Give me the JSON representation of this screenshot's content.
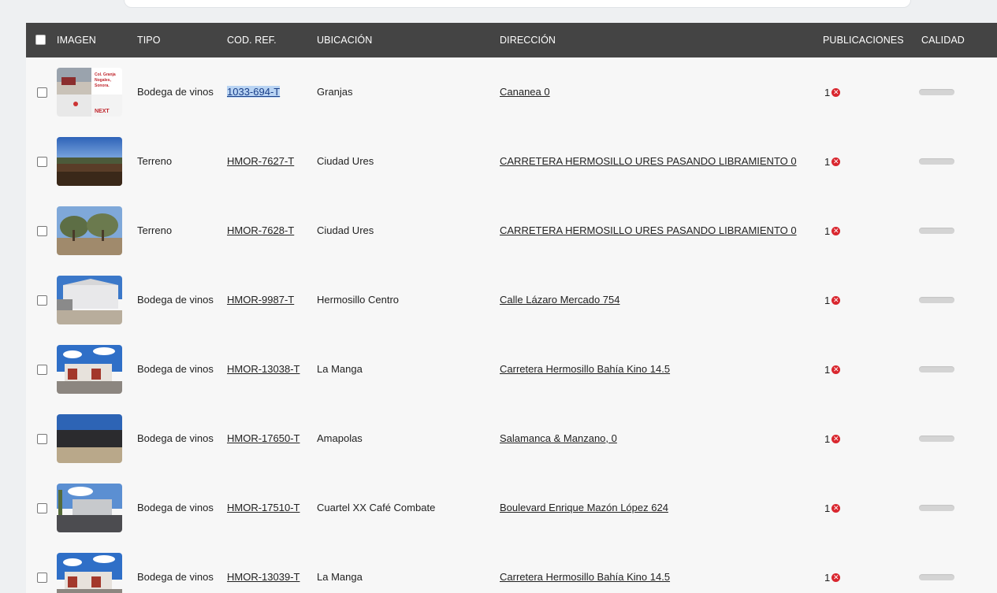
{
  "table": {
    "headers": {
      "image": "IMAGEN",
      "type": "TIPO",
      "ref": "COD. REF.",
      "location": "UBICACIÓN",
      "address": "DIRECCIÓN",
      "publications": "PUBLICACIONES",
      "quality": "CALIDAD"
    },
    "rows": [
      {
        "type": "Bodega de vinos",
        "ref": "1033-694-T",
        "location": "Granjas",
        "address": "Cananea 0",
        "publications": "1",
        "thumb": "flyer"
      },
      {
        "type": "Terreno",
        "ref": "HMOR-7627-T",
        "location": "Ciudad Ures",
        "address": "CARRETERA HERMOSILLO URES PASANDO LIBRAMIENTO 0",
        "publications": "1",
        "thumb": "land"
      },
      {
        "type": "Terreno",
        "ref": "HMOR-7628-T",
        "location": "Ciudad Ures",
        "address": "CARRETERA HERMOSILLO URES PASANDO LIBRAMIENTO 0",
        "publications": "1",
        "thumb": "trees"
      },
      {
        "type": "Bodega de vinos",
        "ref": "HMOR-9987-T",
        "location": "Hermosillo Centro",
        "address": "Calle Lázaro Mercado 754",
        "publications": "1",
        "thumb": "warehouse"
      },
      {
        "type": "Bodega de vinos",
        "ref": "HMOR-13038-T",
        "location": "La Manga",
        "address": "Carretera Hermosillo Bahía Kino 14.5",
        "publications": "1",
        "thumb": "building"
      },
      {
        "type": "Bodega de vinos",
        "ref": "HMOR-17650-T",
        "location": "Amapolas",
        "address": "Salamanca & Manzano, 0",
        "publications": "1",
        "thumb": "shed"
      },
      {
        "type": "Bodega de vinos",
        "ref": "HMOR-17510-T",
        "location": "Cuartel XX Café Combate",
        "address": "Boulevard Enrique Mazón López 624",
        "publications": "1",
        "thumb": "yard"
      },
      {
        "type": "Bodega de vinos",
        "ref": "HMOR-13039-T",
        "location": "La Manga",
        "address": "Carretera Hermosillo Bahía Kino 14.5",
        "publications": "1",
        "thumb": "building"
      }
    ]
  },
  "flyer": {
    "line1": "Col. Granja",
    "line2": "Nogales,",
    "line3": "Sonora.",
    "logo": "NEXT"
  },
  "colors": {
    "header_bg": "#444444",
    "error": "#d9262e",
    "selection": "#b9d4f3"
  },
  "icons": {
    "publication_status": "x-circle-icon"
  }
}
